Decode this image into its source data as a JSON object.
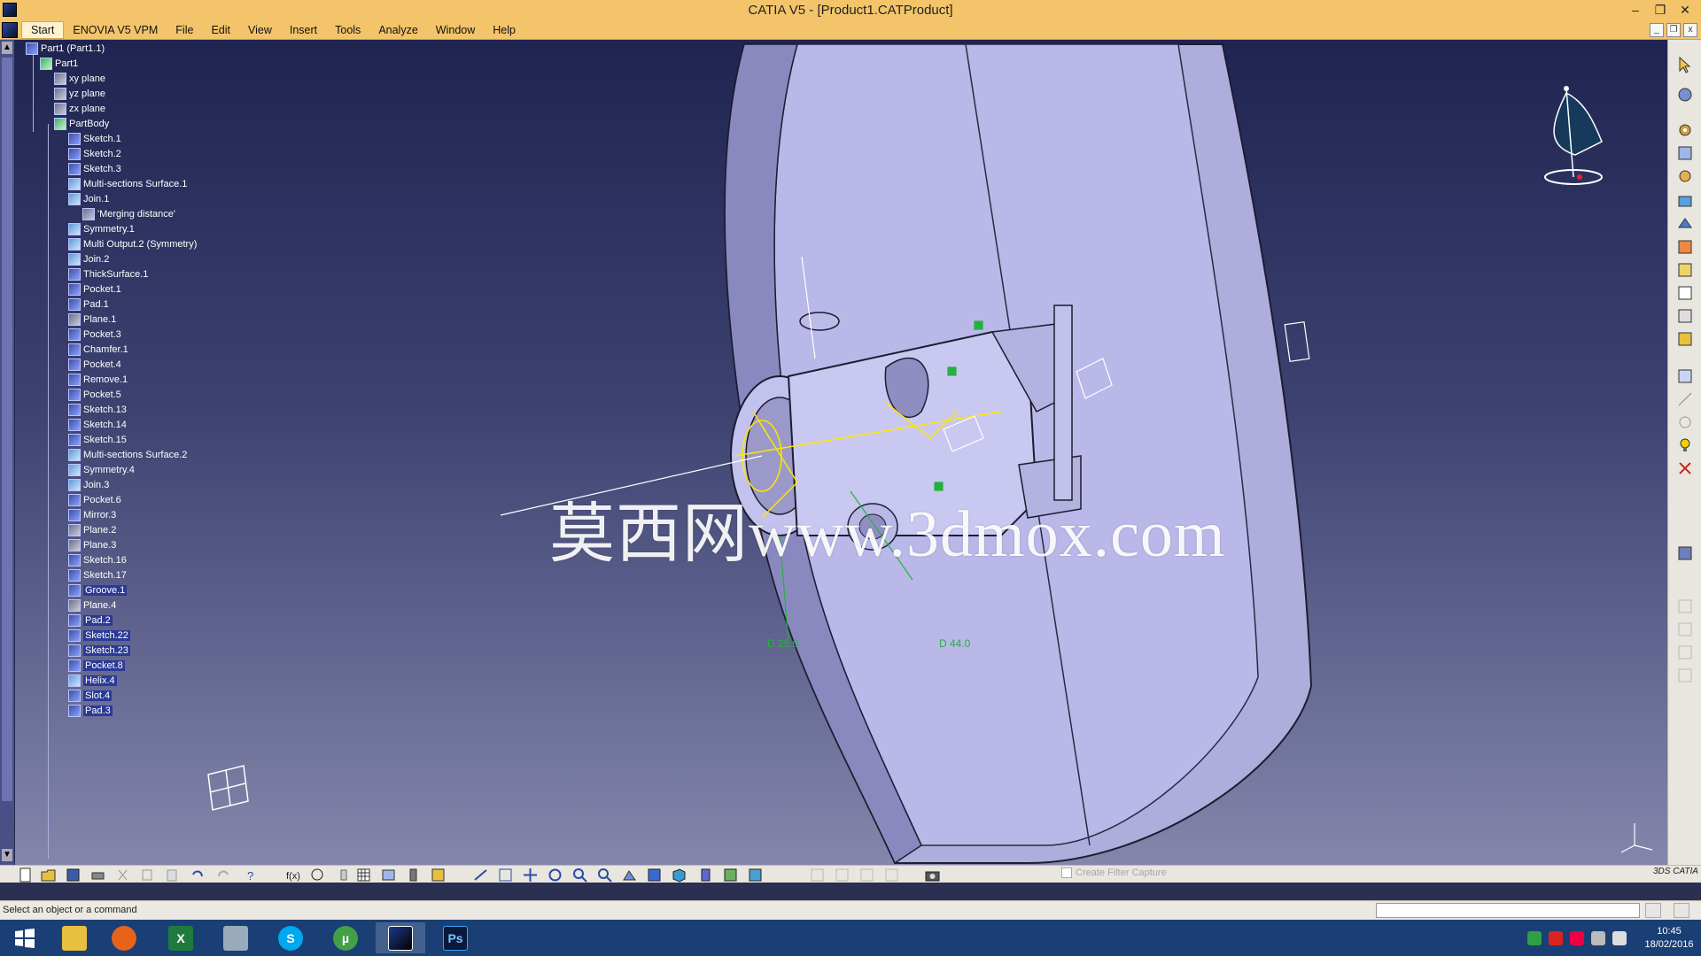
{
  "window": {
    "title": "CATIA V5 - [Product1.CATProduct]",
    "controls": [
      "–",
      "❐",
      "✕"
    ],
    "doc_controls": [
      "_",
      "❐",
      "x"
    ]
  },
  "menu": {
    "items": [
      "Start",
      "ENOVIA V5 VPM",
      "File",
      "Edit",
      "View",
      "Insert",
      "Tools",
      "Analyze",
      "Window",
      "Help"
    ]
  },
  "tree": {
    "root": "Part1 (Part1.1)",
    "part": "Part1",
    "planes": [
      "xy plane",
      "yz plane",
      "zx plane"
    ],
    "body": "PartBody",
    "features": [
      "Sketch.1",
      "Sketch.2",
      "Sketch.3",
      "Multi-sections Surface.1",
      "Join.1",
      "'Merging distance'",
      "Symmetry.1",
      "Multi Output.2 (Symmetry)",
      "Join.2",
      "ThickSurface.1",
      "Pocket.1",
      "Pad.1",
      "Plane.1",
      "Pocket.3",
      "Chamfer.1",
      "Pocket.4",
      "Remove.1",
      "Pocket.5",
      "Sketch.13",
      "Sketch.14",
      "Sketch.15",
      "Multi-sections Surface.2",
      "Symmetry.4",
      "Join.3",
      "Pocket.6",
      "Mirror.3",
      "Plane.2",
      "Plane.3",
      "Sketch.16",
      "Sketch.17",
      "Groove.1",
      "Plane.4",
      "Pad.2",
      "Sketch.22",
      "Sketch.23",
      "Pocket.8",
      "Helix.4",
      "Slot.4",
      "Pad.3"
    ]
  },
  "viewport": {
    "watermark": "莫西网www.3dmox.com",
    "dimensions": [
      "D 25.0",
      "D 44.0"
    ]
  },
  "bottom_toolbar": {
    "filter_label": "Create Filter Capture",
    "logo": "3DS CATIA"
  },
  "status": {
    "message": "Select an object or a command"
  },
  "taskbar": {
    "apps": [
      "windows-start",
      "file-explorer",
      "firefox",
      "excel",
      "calculator",
      "skype",
      "utorrent",
      "catia",
      "photoshop"
    ],
    "ps_label": "Ps",
    "skype_label": "S",
    "excel_label": "X",
    "utorrent_label": "µ"
  },
  "clock": {
    "time": "10:45",
    "date": "18/02/2016"
  },
  "colors": {
    "titlebar": "#f3c46a",
    "viewport_top": "#1f2450",
    "viewport_bottom": "#8486ab",
    "model": "#b7b6e6",
    "sketch": "#ffe600",
    "dimension": "#25b140"
  }
}
